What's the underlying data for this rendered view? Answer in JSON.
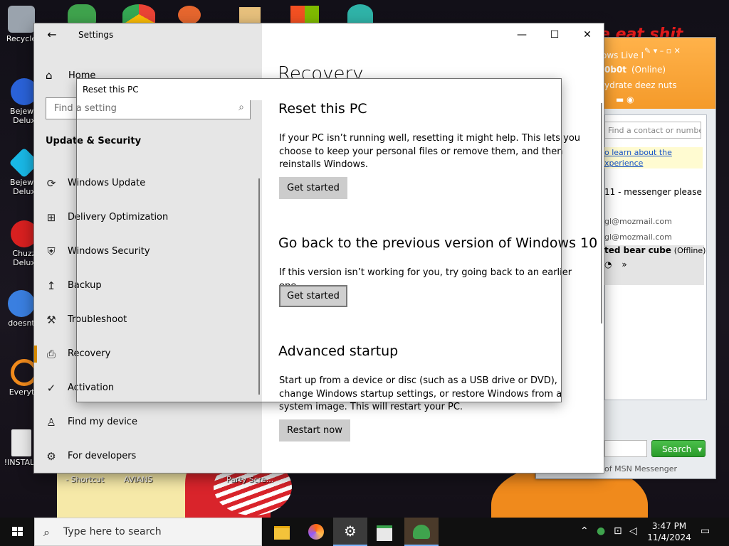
{
  "desktop": {
    "icons": [
      {
        "label": "Recycle",
        "color": "#9aa3ad"
      },
      {
        "label": "Bejewe\nDelux",
        "color": "#2a62d8"
      },
      {
        "label": "Bejewe\nDelux",
        "color": "#19b8e6"
      },
      {
        "label": "Chuzz\nDelux",
        "color": "#d82020"
      },
      {
        "label": "doesnt",
        "color": "#3a7fe0"
      },
      {
        "label": "Everyth",
        "color": "#f08a1c"
      },
      {
        "label": "!INSTALL",
        "color": "#e8e8e8"
      }
    ],
    "bottom_labels": [
      "- Shortcut",
      "AVIANS",
      "Party Scre..."
    ],
    "overlay_text": "e eat shit"
  },
  "msn": {
    "title_line": "ows Live I",
    "status_name": "0b0t",
    "status": "(Online)",
    "personal_msg": "ydrate deez nuts",
    "find_placeholder": "Find a contact or numbe",
    "learn_link_1": "o learn about the",
    "learn_link_2": "xperience",
    "contact_1": "11 - messenger please",
    "contact_2": "gl@mozmail.com",
    "contact_3": "gl@mozmail.com",
    "contact_4": "ted bear cube",
    "contact_4_status": "(Offline)",
    "more": "»",
    "search_button": "Search",
    "footer": "of MSN Messenger"
  },
  "settings": {
    "window_title": "Settings",
    "home": "Home",
    "search_placeholder": "Find a setting",
    "section_title": "Update & Security",
    "nav": [
      {
        "label": "Windows Update",
        "icon": "refresh-icon"
      },
      {
        "label": "Delivery Optimization",
        "icon": "delivery-icon"
      },
      {
        "label": "Windows Security",
        "icon": "shield-icon"
      },
      {
        "label": "Backup",
        "icon": "backup-arrow-icon"
      },
      {
        "label": "Troubleshoot",
        "icon": "wrench-icon"
      },
      {
        "label": "Recovery",
        "icon": "recovery-icon",
        "selected": true
      },
      {
        "label": "Activation",
        "icon": "check-circle-icon"
      },
      {
        "label": "Find my device",
        "icon": "person-pin-icon"
      },
      {
        "label": "For developers",
        "icon": "developer-icon"
      }
    ],
    "page_title": "Recovery",
    "reset": {
      "title": "Reset this PC",
      "text": "If your PC isn’t running well, resetting it might help. This lets you choose to keep your personal files or remove them, and then reinstalls Windows.",
      "button": "Get started"
    },
    "goback": {
      "title": "Go back to the previous version of Windows 10",
      "text": "If this version isn’t working for you, try going back to an earlier one.",
      "button": "Get started"
    },
    "advanced": {
      "title": "Advanced startup",
      "text": "Start up from a device or disc (such as a USB drive or DVD), change Windows startup settings, or restore Windows from a system image. This will restart your PC.",
      "button": "Restart now"
    },
    "accent": "#d68a00"
  },
  "reset_dialog": {
    "title": "Reset this PC"
  },
  "taskbar": {
    "search_placeholder": "Type here to search",
    "time": "3:47 PM",
    "date": "11/4/2024",
    "apps": [
      "file-explorer-icon",
      "firefox-icon",
      "settings-gear-icon",
      "app-window-icon",
      "msn-messenger-icon"
    ]
  }
}
